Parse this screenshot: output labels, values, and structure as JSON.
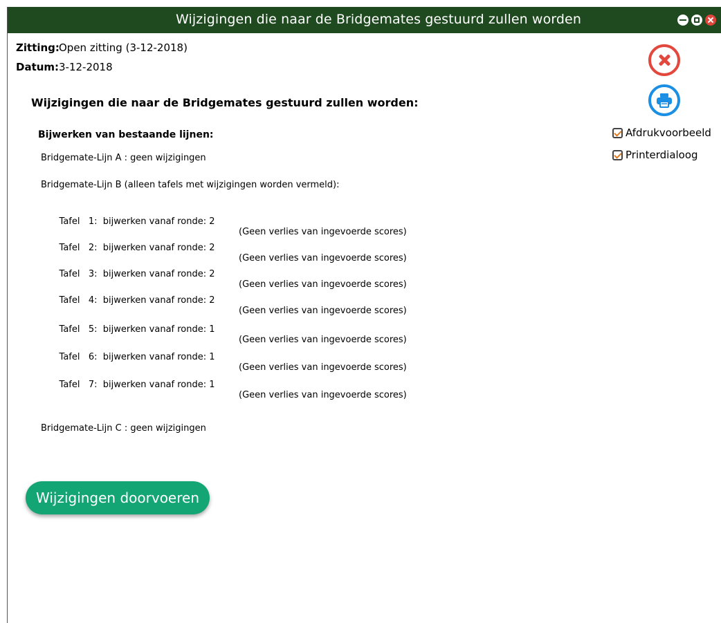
{
  "window": {
    "title": "Wijzigingen die naar de Bridgemates gestuurd zullen worden"
  },
  "meta": {
    "zitting_label": "Zitting:",
    "zitting_value": "Open zitting (3-12-2018)",
    "datum_label": "Datum:",
    "datum_value": "3-12-2018"
  },
  "content": {
    "heading": "Wijzigingen die naar de Bridgemates gestuurd zullen worden:",
    "subheading": "Bijwerken van bestaande lijnen:",
    "lijn_a": "Bridgemate-Lijn A : geen wijzigingen",
    "lijn_b": "Bridgemate-Lijn B  (alleen tafels met wijzigingen worden vermeld):",
    "lijn_c": "Bridgemate-Lijn C : geen wijzigingen",
    "tafels": [
      {
        "text": "Tafel   1:  bijwerken vanaf ronde: 2",
        "note": "(Geen verlies van ingevoerde scores)"
      },
      {
        "text": "Tafel   2:  bijwerken vanaf ronde: 2",
        "note": "(Geen verlies van ingevoerde scores)"
      },
      {
        "text": "Tafel   3:  bijwerken vanaf ronde: 2",
        "note": "(Geen verlies van ingevoerde scores)"
      },
      {
        "text": "Tafel   4:  bijwerken vanaf ronde: 2",
        "note": "(Geen verlies van ingevoerde scores)"
      },
      {
        "text": "Tafel   5:  bijwerken vanaf ronde: 1",
        "note": "(Geen verlies van ingevoerde scores)"
      },
      {
        "text": "Tafel   6:  bijwerken vanaf ronde: 1",
        "note": "(Geen verlies van ingevoerde scores)"
      },
      {
        "text": "Tafel   7:  bijwerken vanaf ronde: 1",
        "note": "(Geen verlies van ingevoerde scores)"
      }
    ]
  },
  "actions": {
    "apply_label": "Wijzigingen doorvoeren"
  },
  "options": {
    "afdrukvoorbeeld_label": "Afdrukvoorbeeld",
    "afdrukvoorbeeld_checked": true,
    "printerdialoog_label": "Printerdialoog",
    "printerdialoog_checked": true
  },
  "icons": {
    "cancel": "cancel-icon",
    "print": "print-icon",
    "minimize": "minimize-icon",
    "maximize": "maximize-icon",
    "close": "close-icon"
  },
  "colors": {
    "titlebar": "#1f4a1f",
    "apply_button": "#14a574",
    "cancel": "#e2483d",
    "print": "#1a8fe3",
    "checkmark": "#e07b1f"
  }
}
